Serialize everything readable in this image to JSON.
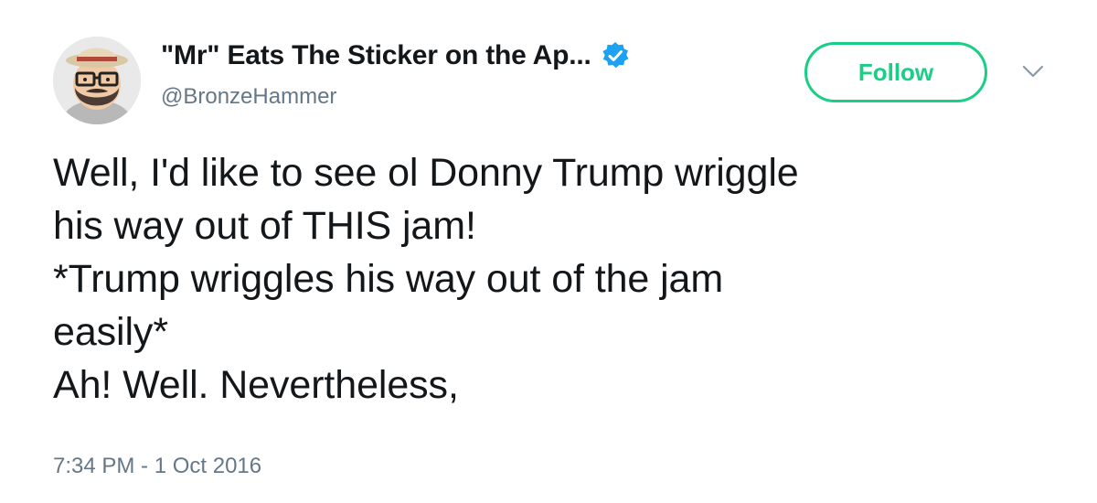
{
  "author": {
    "display_name": "\"Mr\" Eats The Sticker on the Ap...",
    "handle": "@BronzeHammer",
    "avatar_icon": "cartoon-avatar-with-hat-and-glasses",
    "verified_icon": "verified-badge-icon",
    "verified_color": "#1da1f2"
  },
  "actions": {
    "follow_label": "Follow",
    "follow_color": "#19cf86",
    "more_icon": "chevron-down-icon"
  },
  "tweet": {
    "lines": [
      "Well, I'd like to see ol Donny Trump wriggle",
      "his way out of THIS jam!",
      "*Trump wriggles his way out of the jam",
      "easily*",
      "Ah! Well. Nevertheless,"
    ],
    "timestamp": "7:34 PM - 1 Oct 2016"
  }
}
